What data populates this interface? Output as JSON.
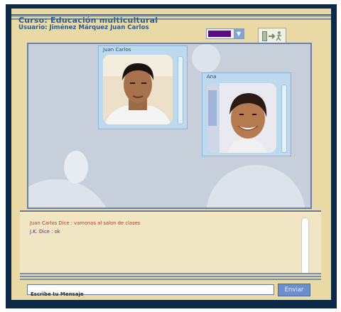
{
  "header": {
    "title": "Curso: Educación multicultural",
    "user": "Usuario: Jiménez Márquez Juan Carlos"
  },
  "toolbar": {
    "color_swatch": "#5a0a86",
    "exit_icon": "exit-door-icon"
  },
  "videos": [
    {
      "name": "Juan Carlos"
    },
    {
      "name": "Ana"
    }
  ],
  "chat": {
    "messages": [
      {
        "text": "Juan Carlos Dice : vamonos al salon de clases",
        "color": "#b13a2a"
      },
      {
        "text": "J.K. Dice : ok",
        "color": "#6a1aa0"
      }
    ]
  },
  "composer": {
    "placeholder": "Escribe tu Mensaje",
    "send_label": "Enviar"
  }
}
